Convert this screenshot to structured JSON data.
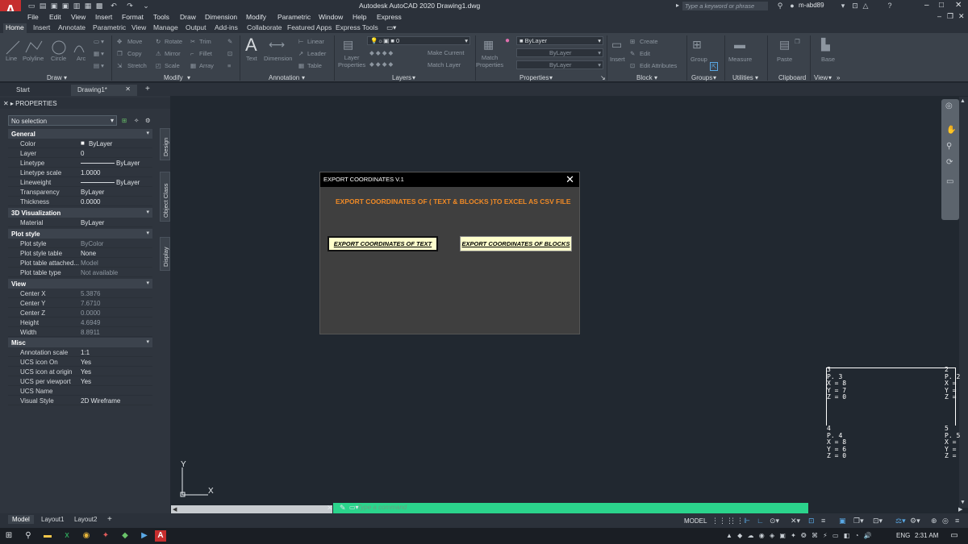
{
  "app": {
    "logo": "A",
    "window_title": "Autodesk AutoCAD 2020   Drawing1.dwg",
    "search_placeholder": "Type a keyword or phrase",
    "user": "m-abd89"
  },
  "menu": [
    "File",
    "Edit",
    "View",
    "Insert",
    "Format",
    "Tools",
    "Draw",
    "Dimension",
    "Modify",
    "Parametric",
    "Window",
    "Help",
    "Express"
  ],
  "ribbon_tabs": [
    "Home",
    "Insert",
    "Annotate",
    "Parametric",
    "View",
    "Manage",
    "Output",
    "Add-ins",
    "Collaborate",
    "Featured Apps",
    "Express Tools"
  ],
  "ribbon": {
    "draw": {
      "line": "Line",
      "polyline": "Polyline",
      "circle": "Circle",
      "arc": "Arc",
      "title": "Draw"
    },
    "modify": {
      "move": "Move",
      "rotate": "Rotate",
      "trim": "Trim",
      "copy": "Copy",
      "mirror": "Mirror",
      "fillet": "Fillet",
      "stretch": "Stretch",
      "scale": "Scale",
      "array": "Array",
      "title": "Modify"
    },
    "annotation": {
      "text": "Text",
      "dimension": "Dimension",
      "linear": "Linear",
      "leader": "Leader",
      "table": "Table",
      "title": "Annotation"
    },
    "layers": {
      "layer_props": "Layer\nProperties",
      "current_layer": "0",
      "make_current": "Make Current",
      "match_layer": "Match Layer",
      "title": "Layers"
    },
    "properties": {
      "match": "Match\nProperties",
      "color": "ByLayer",
      "linetype": "ByLayer",
      "lineweight": "ByLayer",
      "title": "Properties"
    },
    "block": {
      "insert": "Insert",
      "create": "Create",
      "edit": "Edit",
      "edit_attr": "Edit Attributes",
      "title": "Block"
    },
    "groups": {
      "group": "Group",
      "title": "Groups"
    },
    "utilities": {
      "measure": "Measure",
      "title": "Utilities"
    },
    "clipboard": {
      "paste": "Paste",
      "title": "Clipboard"
    },
    "view": {
      "base": "Base",
      "title": "View"
    }
  },
  "doc_tabs": {
    "start": "Start",
    "drawing": "Drawing1*"
  },
  "properties": {
    "header": "PROPERTIES",
    "selection": "No selection",
    "sections": {
      "general": "General",
      "viz": "3D Visualization",
      "plot": "Plot style",
      "view": "View",
      "misc": "Misc"
    },
    "general": [
      {
        "k": "Color",
        "v": "ByLayer"
      },
      {
        "k": "Layer",
        "v": "0"
      },
      {
        "k": "Linetype",
        "v": "ByLayer"
      },
      {
        "k": "Linetype scale",
        "v": "1.0000"
      },
      {
        "k": "Lineweight",
        "v": "ByLayer"
      },
      {
        "k": "Transparency",
        "v": "ByLayer"
      },
      {
        "k": "Thickness",
        "v": "0.0000"
      }
    ],
    "viz": [
      {
        "k": "Material",
        "v": "ByLayer"
      }
    ],
    "plot": [
      {
        "k": "Plot style",
        "v": "ByColor"
      },
      {
        "k": "Plot style table",
        "v": "None"
      },
      {
        "k": "Plot table attached...",
        "v": "Model"
      },
      {
        "k": "Plot table type",
        "v": "Not available"
      }
    ],
    "view": [
      {
        "k": "Center X",
        "v": "5.3876"
      },
      {
        "k": "Center Y",
        "v": "7.6710"
      },
      {
        "k": "Center Z",
        "v": "0.0000"
      },
      {
        "k": "Height",
        "v": "4.6949"
      },
      {
        "k": "Width",
        "v": "8.8911"
      }
    ],
    "misc": [
      {
        "k": "Annotation scale",
        "v": "1:1"
      },
      {
        "k": "UCS icon On",
        "v": "Yes"
      },
      {
        "k": "UCS icon at origin",
        "v": "Yes"
      },
      {
        "k": "UCS per viewport",
        "v": "Yes"
      },
      {
        "k": "UCS Name",
        "v": ""
      },
      {
        "k": "Visual Style",
        "v": "2D Wireframe"
      }
    ],
    "side_tabs": [
      "Design",
      "Object Class",
      "Display"
    ]
  },
  "dialog": {
    "title": "EXPORT COORDINATES V.1",
    "close": "✕",
    "heading": "EXPORT COORDINATES OF ( TEXT & BLOCKS )TO EXCEL AS CSV FILE",
    "btn_text": "EXPORT COORDINATES OF TEXT",
    "btn_blocks": "EXPORT COORDINATES OF BLOCKS"
  },
  "drawing": {
    "pt3": "3\nP. 3\nX = 8\nY = 7\nZ = 0",
    "pt2": "2\nP. 2\nX =\nY =\nZ =",
    "pt4": "4\nP. 4\nX = 8\nY = 6\nZ = 0",
    "pt5": "5\nP. 5\nX =\nY =\nZ =",
    "ucs_x": "X",
    "ucs_y": "Y"
  },
  "command": {
    "placeholder": "Type a command"
  },
  "layout_tabs": [
    "Model",
    "Layout1",
    "Layout2"
  ],
  "status": {
    "model": "MODEL"
  },
  "taskbar": {
    "lang": "ENG",
    "clock": "2:31 AM"
  },
  "colors": {
    "dialog_heading": "#f08a26",
    "button_bg": "#ffffcc",
    "command_bg": "#2bd48c",
    "logo_red": "#c62e2e"
  }
}
